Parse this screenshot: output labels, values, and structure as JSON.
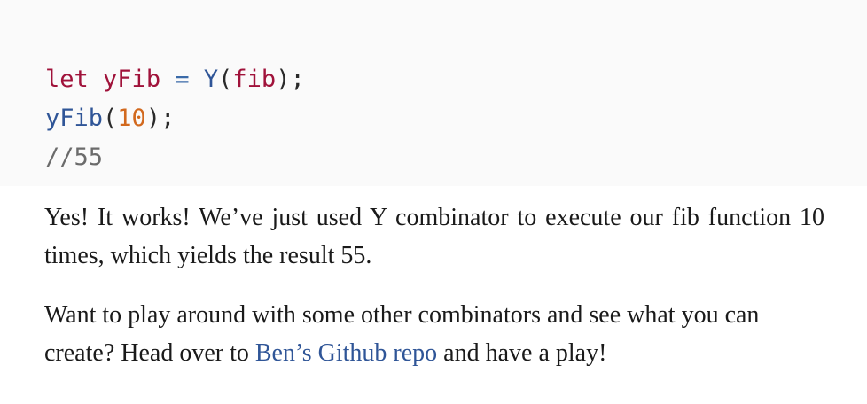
{
  "code": {
    "line1": {
      "keyword": "let",
      "variable": "yFib",
      "operator": "=",
      "function": "Y",
      "open": "(",
      "argument": "fib",
      "close": ");"
    },
    "line2": {
      "function": "yFib",
      "open": "(",
      "number": "10",
      "close": ");"
    },
    "line3": {
      "comment": "//55"
    }
  },
  "paragraph1": {
    "text": "Yes! It works! We’ve just used Y combinator to execute our fib function 10 times, which yields the result 55."
  },
  "paragraph2": {
    "before": "Want to play around with some other combinators and see what you can create? Head over to ",
    "link": "Ben’s Github repo",
    "after": " and have a play!"
  },
  "colors": {
    "keyword": "#a0123a",
    "function": "#2f5597",
    "number": "#d2691e",
    "comment": "#6b6b6b",
    "link": "#2f5597",
    "code_background": "#fafafa"
  }
}
